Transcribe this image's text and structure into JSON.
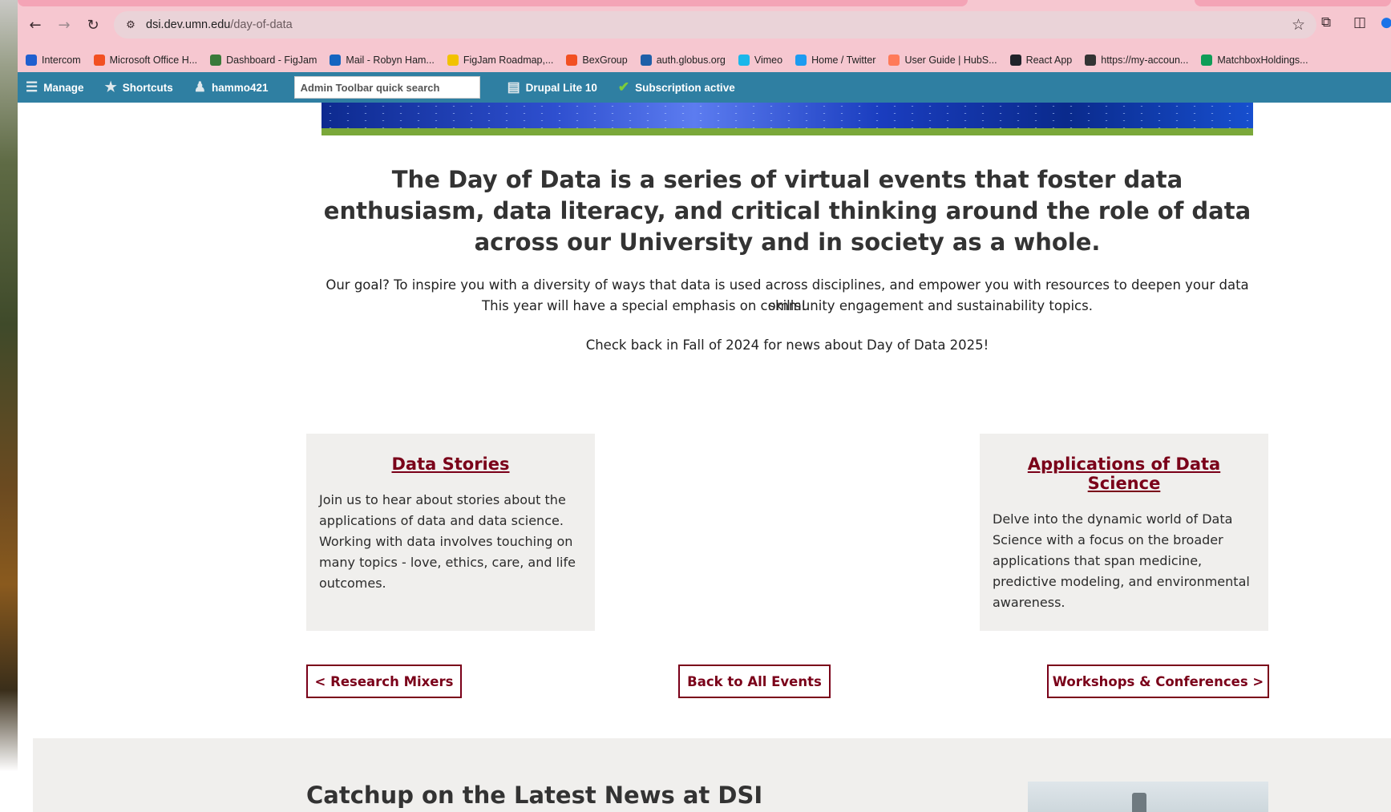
{
  "browser": {
    "url_host": "dsi.dev.umn.edu",
    "url_path": "/day-of-data"
  },
  "bookmarks": [
    {
      "label": "Intercom",
      "icon": "intercom-icon",
      "color": "#1f5fcf"
    },
    {
      "label": "Microsoft Office H...",
      "icon": "microsoft-icon",
      "color": "#f25022"
    },
    {
      "label": "Dashboard - FigJam",
      "icon": "figjam-icon",
      "color": "#3a7a3a"
    },
    {
      "label": "Mail - Robyn Ham...",
      "icon": "outlook-icon",
      "color": "#1565c0"
    },
    {
      "label": "FigJam Roadmap,...",
      "icon": "miro-icon",
      "color": "#f2c200"
    },
    {
      "label": "BexGroup",
      "icon": "microsoft-icon",
      "color": "#f25022"
    },
    {
      "label": "auth.globus.org",
      "icon": "globus-icon",
      "color": "#1f5fa8"
    },
    {
      "label": "Vimeo",
      "icon": "vimeo-icon",
      "color": "#1ab7ea"
    },
    {
      "label": "Home / Twitter",
      "icon": "twitter-icon",
      "color": "#1d9bf0"
    },
    {
      "label": "User Guide | HubS...",
      "icon": "hubspot-icon",
      "color": "#ff7a59"
    },
    {
      "label": "React App",
      "icon": "react-icon",
      "color": "#20232a"
    },
    {
      "label": "https://my-accoun...",
      "icon": "globe-icon",
      "color": "#333333"
    },
    {
      "label": "MatchboxHoldings...",
      "icon": "sheets-icon",
      "color": "#0f9d58"
    }
  ],
  "toolbar": {
    "manage": "Manage",
    "shortcuts": "Shortcuts",
    "user": "hammo421",
    "search_placeholder": "Admin Toolbar quick search",
    "site": "Drupal Lite 10",
    "subscription": "Subscription active"
  },
  "main": {
    "heading": "The Day of Data is a series of virtual events that foster data enthusiasm, data literacy, and critical thinking around the role of data across our University and in society as a whole.",
    "goal_line1": "Our goal? To inspire you with a diversity of ways that data is used across disciplines, and empower you with resources to deepen your data skills!",
    "goal_line2": "This year will have a special emphasis on community engagement and sustainability topics.",
    "check_back": "Check back in Fall of 2024 for news about Day of Data 2025!"
  },
  "cards": [
    {
      "title": "Data Stories",
      "body": "Join us to hear about stories about the applications of data and data science. Working with data involves touching on many topics - love, ethics, care, and life outcomes."
    },
    {
      "title": "Applications of Data Science",
      "body": "Delve into the dynamic world of Data Science with a focus on the broader applications that span medicine, predictive modeling, and environmental awareness."
    }
  ],
  "pager": {
    "prev": "< Research Mixers",
    "back": "Back to All Events",
    "next": "Workshops & Conferences >"
  },
  "news": {
    "title": "Catchup on the Latest News at DSI"
  },
  "colors": {
    "toolbar": "#2f7fa2",
    "maroon": "#7a0019",
    "chrome": "#f6c7d0",
    "card_bg": "#f0efed"
  }
}
